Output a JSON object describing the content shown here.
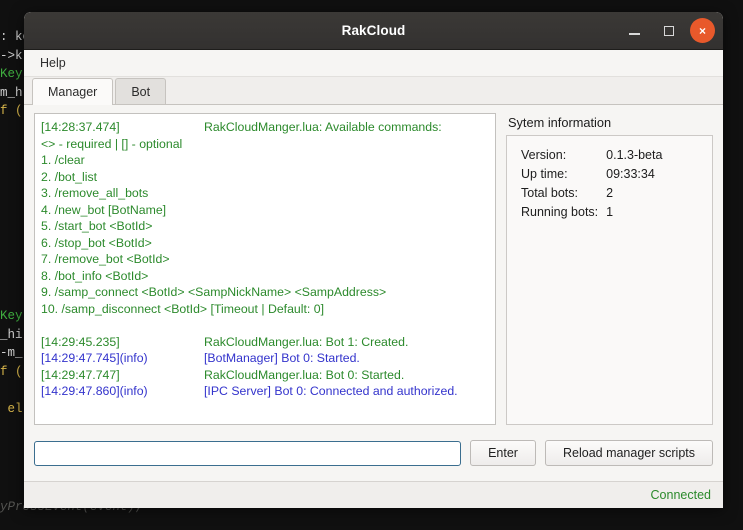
{
  "desktop": {
    "code_lines": [
      ": ke",
      "->k",
      "Key",
      "m_h",
      "f (",
      "",
      "",
      "",
      "",
      "",
      "",
      "",
      "",
      "",
      "",
      "Key",
      "_hi",
      "-m_",
      "f (",
      "",
      " el"
    ],
    "bottom_code": "yPressEvent(event);"
  },
  "window": {
    "title": "RakCloud",
    "controls": {
      "minimize": "minimize-button",
      "maximize": "maximize-button",
      "close": "×"
    }
  },
  "menubar": {
    "items": [
      {
        "label": "Help"
      }
    ]
  },
  "tabs": [
    {
      "label": "Manager",
      "active": true
    },
    {
      "label": "Bot",
      "active": false
    }
  ],
  "log": {
    "lines": [
      {
        "ts": "[14:28:37.474]",
        "msg": "RakCloudManger.lua: Available commands:",
        "ts_color": "g",
        "msg_color": "g"
      },
      {
        "ts": "",
        "msg": "<> - required | [] - optional",
        "ts_color": "g",
        "msg_color": "g",
        "full": true
      },
      {
        "ts": "",
        "msg": "1. /clear",
        "ts_color": "g",
        "msg_color": "g",
        "full": true
      },
      {
        "ts": "",
        "msg": "2. /bot_list",
        "ts_color": "g",
        "msg_color": "g",
        "full": true
      },
      {
        "ts": "",
        "msg": "3. /remove_all_bots",
        "ts_color": "g",
        "msg_color": "g",
        "full": true
      },
      {
        "ts": "",
        "msg": "4. /new_bot [BotName]",
        "ts_color": "g",
        "msg_color": "g",
        "full": true
      },
      {
        "ts": "",
        "msg": "5. /start_bot <BotId>",
        "ts_color": "g",
        "msg_color": "g",
        "full": true
      },
      {
        "ts": "",
        "msg": "6. /stop_bot <BotId>",
        "ts_color": "g",
        "msg_color": "g",
        "full": true
      },
      {
        "ts": "",
        "msg": "7. /remove_bot <BotId>",
        "ts_color": "g",
        "msg_color": "g",
        "full": true
      },
      {
        "ts": "",
        "msg": "8. /bot_info <BotId>",
        "ts_color": "g",
        "msg_color": "g",
        "full": true
      },
      {
        "ts": "",
        "msg": "9. /samp_connect <BotId> <SampNickName> <SampAddress>",
        "ts_color": "g",
        "msg_color": "g",
        "full": true
      },
      {
        "ts": "",
        "msg": "10. /samp_disconnect <BotId> [Timeout | Default: 0]",
        "ts_color": "g",
        "msg_color": "g",
        "full": true
      },
      {
        "ts": "",
        "msg": "",
        "ts_color": "g",
        "msg_color": "g",
        "full": true
      },
      {
        "ts": "[14:29:45.235]",
        "msg": "RakCloudManger.lua: Bot 1: Created.",
        "ts_color": "g",
        "msg_color": "g"
      },
      {
        "ts": "[14:29:47.745](info)",
        "msg": "[BotManager] Bot 0: Started.",
        "ts_color": "b",
        "msg_color": "b"
      },
      {
        "ts": "[14:29:47.747]",
        "msg": "RakCloudManger.lua: Bot 0: Started.",
        "ts_color": "g",
        "msg_color": "g"
      },
      {
        "ts": "[14:29:47.860](info)",
        "msg": "[IPC Server] Bot 0: Connected and authorized.",
        "ts_color": "b",
        "msg_color": "b"
      }
    ]
  },
  "system_info": {
    "title": "Sytem information",
    "rows": [
      {
        "label": "Version:",
        "value": "0.1.3-beta"
      },
      {
        "label": "Up time:",
        "value": "09:33:34"
      },
      {
        "label": "Total bots:",
        "value": "2"
      },
      {
        "label": "Running bots:",
        "value": "1"
      }
    ]
  },
  "command_bar": {
    "input_value": "",
    "input_placeholder": "",
    "enter_label": "Enter",
    "reload_label": "Reload manager scripts"
  },
  "statusbar": {
    "status": "Connected"
  },
  "colors": {
    "log_green": "#2c8a2c",
    "log_blue": "#3333cc",
    "status_green": "#2c8a2c",
    "close_orange": "#e8592b",
    "titlebar": "#37352f"
  }
}
